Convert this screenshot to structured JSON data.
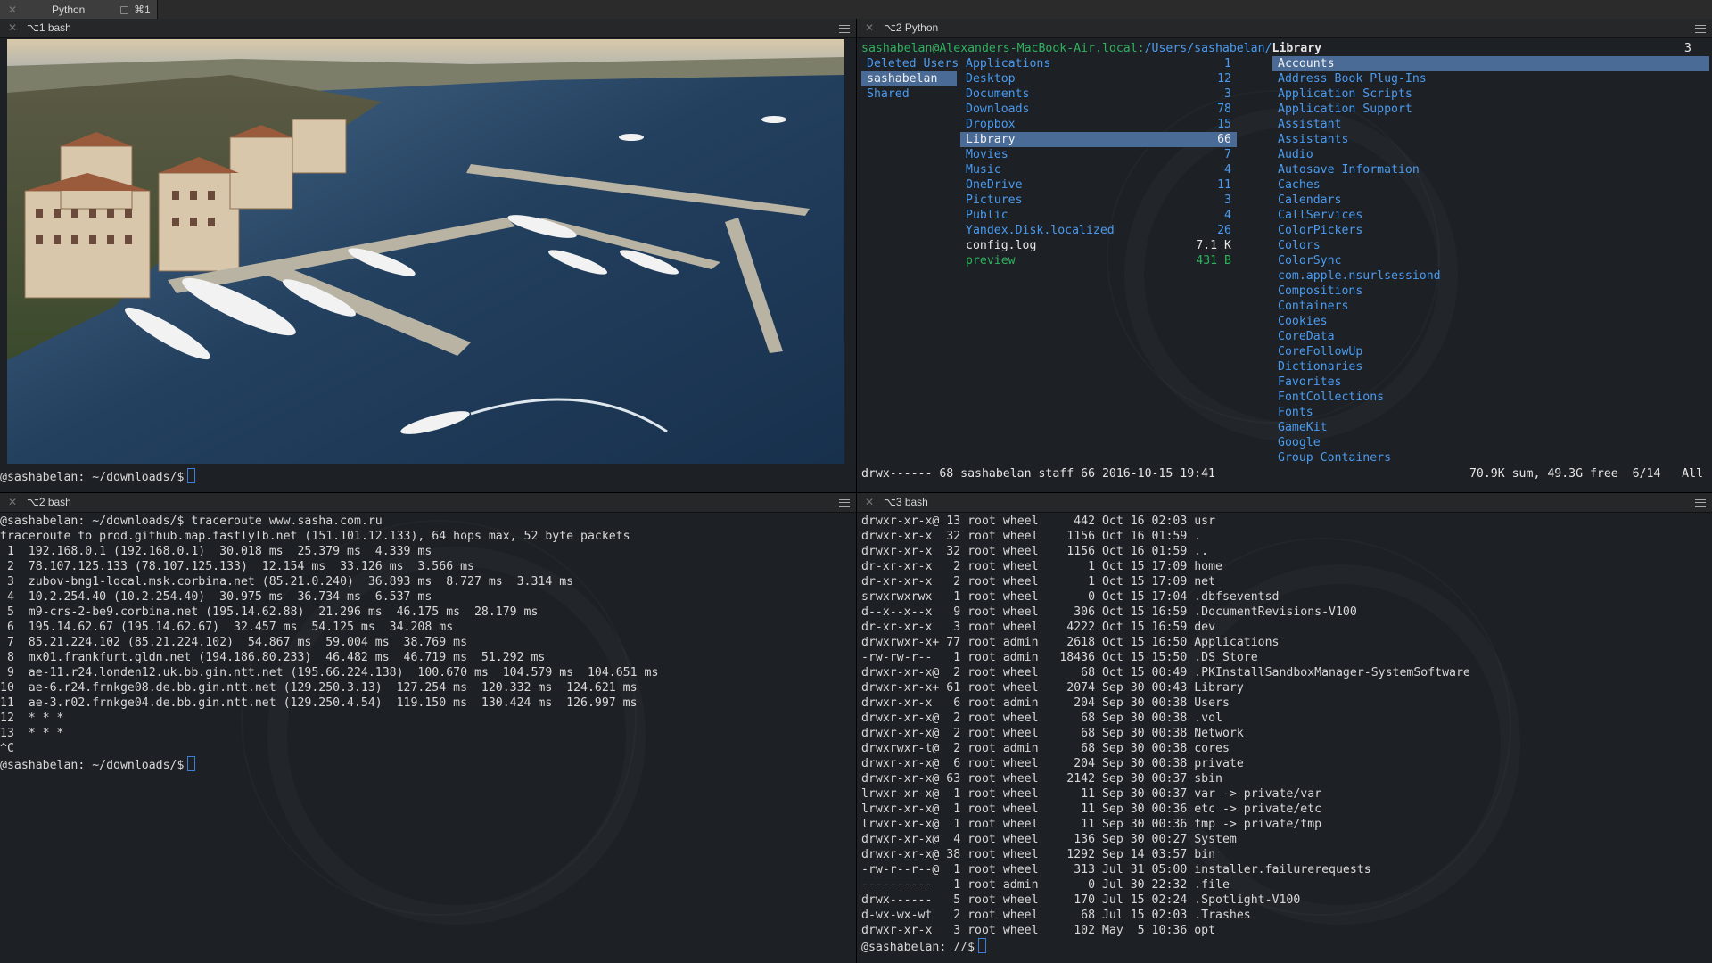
{
  "window": {
    "tab_close": "✕",
    "tab_title": "Python",
    "tab_shortcut": "⌘1"
  },
  "panes": {
    "top_left": {
      "title": "⌥1  bash",
      "prompt": "@sashabelan: ~/downloads/$"
    },
    "top_right": {
      "title": "⌥2  Python",
      "path_prefix": "sashabelan@Alexanders-MacBook-Air.local:",
      "path_dir": "/Users/sashabelan/",
      "path_leaf": "Library",
      "tab_count": "3",
      "col1": [
        "Deleted Users",
        "sashabelan",
        "Shared"
      ],
      "col2": [
        {
          "name": "Applications",
          "count": "1"
        },
        {
          "name": "Desktop",
          "count": "12"
        },
        {
          "name": "Documents",
          "count": "3"
        },
        {
          "name": "Downloads",
          "count": "78"
        },
        {
          "name": "Dropbox",
          "count": "15"
        },
        {
          "name": "Library",
          "count": "66"
        },
        {
          "name": "Movies",
          "count": "7"
        },
        {
          "name": "Music",
          "count": "4"
        },
        {
          "name": "OneDrive",
          "count": "11"
        },
        {
          "name": "Pictures",
          "count": "3"
        },
        {
          "name": "Public",
          "count": "4"
        },
        {
          "name": "Yandex.Disk.localized",
          "count": "26"
        },
        {
          "name": "config.log",
          "count": "7.1 K"
        },
        {
          "name": "preview",
          "count": "431 B"
        }
      ],
      "col3": [
        "Accounts",
        "Address Book Plug-Ins",
        "Application Scripts",
        "Application Support",
        "Assistant",
        "Assistants",
        "Audio",
        "Autosave Information",
        "Caches",
        "Calendars",
        "CallServices",
        "ColorPickers",
        "Colors",
        "ColorSync",
        "com.apple.nsurlsessiond",
        "Compositions",
        "Containers",
        "Cookies",
        "CoreData",
        "CoreFollowUp",
        "Dictionaries",
        "Favorites",
        "FontCollections",
        "Fonts",
        "GameKit",
        "Google",
        "Group Containers"
      ],
      "status_left": "drwx------ 68 sashabelan staff 66 2016-10-15 19:41",
      "status_right": "70.9K sum, 49.3G free  6/14   All"
    },
    "bottom_left": {
      "title": "⌥2  bash",
      "lines": [
        "@sashabelan: ~/downloads/$ traceroute www.sasha.com.ru",
        "traceroute to prod.github.map.fastlylb.net (151.101.12.133), 64 hops max, 52 byte packets",
        " 1  192.168.0.1 (192.168.0.1)  30.018 ms  25.379 ms  4.339 ms",
        " 2  78.107.125.133 (78.107.125.133)  12.154 ms  33.126 ms  3.566 ms",
        " 3  zubov-bng1-local.msk.corbina.net (85.21.0.240)  36.893 ms  8.727 ms  3.314 ms",
        " 4  10.2.254.40 (10.2.254.40)  30.975 ms  36.734 ms  6.537 ms",
        " 5  m9-crs-2-be9.corbina.net (195.14.62.88)  21.296 ms  46.175 ms  28.179 ms",
        " 6  195.14.62.67 (195.14.62.67)  32.457 ms  54.125 ms  34.208 ms",
        " 7  85.21.224.102 (85.21.224.102)  54.867 ms  59.004 ms  38.769 ms",
        " 8  mx01.frankfurt.gldn.net (194.186.80.233)  46.482 ms  46.719 ms  51.292 ms",
        " 9  ae-11.r24.londen12.uk.bb.gin.ntt.net (195.66.224.138)  100.670 ms  104.579 ms  104.651 ms",
        "10  ae-6.r24.frnkge08.de.bb.gin.ntt.net (129.250.3.13)  127.254 ms  120.332 ms  124.621 ms",
        "11  ae-3.r02.frnkge04.de.bb.gin.ntt.net (129.250.4.54)  119.150 ms  130.424 ms  126.997 ms",
        "12  * * *",
        "13  * * *",
        "^C"
      ],
      "prompt": "@sashabelan: ~/downloads/$"
    },
    "bottom_right": {
      "title": "⌥3  bash",
      "rows": [
        [
          "drwxr-xr-x@",
          "13",
          "root",
          "wheel",
          "442",
          "Oct 16 02:03",
          "usr"
        ],
        [
          "drwxr-xr-x",
          "32",
          "root",
          "wheel",
          "1156",
          "Oct 16 01:59",
          "."
        ],
        [
          "drwxr-xr-x",
          "32",
          "root",
          "wheel",
          "1156",
          "Oct 16 01:59",
          ".."
        ],
        [
          "dr-xr-xr-x",
          "2",
          "root",
          "wheel",
          "1",
          "Oct 15 17:09",
          "home"
        ],
        [
          "dr-xr-xr-x",
          "2",
          "root",
          "wheel",
          "1",
          "Oct 15 17:09",
          "net"
        ],
        [
          "srwxrwxrwx",
          "1",
          "root",
          "wheel",
          "0",
          "Oct 15 17:04",
          ".dbfseventsd"
        ],
        [
          "d--x--x--x",
          "9",
          "root",
          "wheel",
          "306",
          "Oct 15 16:59",
          ".DocumentRevisions-V100"
        ],
        [
          "dr-xr-xr-x",
          "3",
          "root",
          "wheel",
          "4222",
          "Oct 15 16:59",
          "dev"
        ],
        [
          "drwxrwxr-x+",
          "77",
          "root",
          "admin",
          "2618",
          "Oct 15 16:50",
          "Applications"
        ],
        [
          "-rw-rw-r--",
          "1",
          "root",
          "admin",
          "18436",
          "Oct 15 15:50",
          ".DS_Store"
        ],
        [
          "drwxr-xr-x@",
          "2",
          "root",
          "wheel",
          "68",
          "Oct 15 00:49",
          ".PKInstallSandboxManager-SystemSoftware"
        ],
        [
          "drwxr-xr-x+",
          "61",
          "root",
          "wheel",
          "2074",
          "Sep 30 00:43",
          "Library"
        ],
        [
          "drwxr-xr-x",
          "6",
          "root",
          "admin",
          "204",
          "Sep 30 00:38",
          "Users"
        ],
        [
          "drwxr-xr-x@",
          "2",
          "root",
          "wheel",
          "68",
          "Sep 30 00:38",
          ".vol"
        ],
        [
          "drwxr-xr-x@",
          "2",
          "root",
          "wheel",
          "68",
          "Sep 30 00:38",
          "Network"
        ],
        [
          "drwxrwxr-t@",
          "2",
          "root",
          "admin",
          "68",
          "Sep 30 00:38",
          "cores"
        ],
        [
          "drwxr-xr-x@",
          "6",
          "root",
          "wheel",
          "204",
          "Sep 30 00:38",
          "private"
        ],
        [
          "drwxr-xr-x@",
          "63",
          "root",
          "wheel",
          "2142",
          "Sep 30 00:37",
          "sbin"
        ],
        [
          "lrwxr-xr-x@",
          "1",
          "root",
          "wheel",
          "11",
          "Sep 30 00:37",
          "var -> private/var"
        ],
        [
          "lrwxr-xr-x@",
          "1",
          "root",
          "wheel",
          "11",
          "Sep 30 00:36",
          "etc -> private/etc"
        ],
        [
          "lrwxr-xr-x@",
          "1",
          "root",
          "wheel",
          "11",
          "Sep 30 00:36",
          "tmp -> private/tmp"
        ],
        [
          "drwxr-xr-x@",
          "4",
          "root",
          "wheel",
          "136",
          "Sep 30 00:27",
          "System"
        ],
        [
          "drwxr-xr-x@",
          "38",
          "root",
          "wheel",
          "1292",
          "Sep 14 03:57",
          "bin"
        ],
        [
          "-rw-r--r--@",
          "1",
          "root",
          "wheel",
          "313",
          "Jul 31 05:00",
          "installer.failurerequests"
        ],
        [
          "----------",
          "1",
          "root",
          "admin",
          "0",
          "Jul 30 22:32",
          ".file"
        ],
        [
          "drwx------",
          "5",
          "root",
          "wheel",
          "170",
          "Jul 15 02:24",
          ".Spotlight-V100"
        ],
        [
          "d-wx-wx-wt",
          "2",
          "root",
          "wheel",
          "68",
          "Jul 15 02:03",
          ".Trashes"
        ],
        [
          "drwxr-xr-x",
          "3",
          "root",
          "wheel",
          "102",
          "May  5 10:36",
          "opt"
        ]
      ],
      "prompt": "@sashabelan: //$"
    }
  },
  "colors": {
    "dir_blue": "#4a9bf0",
    "selection": "#4a6b96",
    "exec_green": "#2fb15e",
    "cursor": "#3d7fd6"
  }
}
